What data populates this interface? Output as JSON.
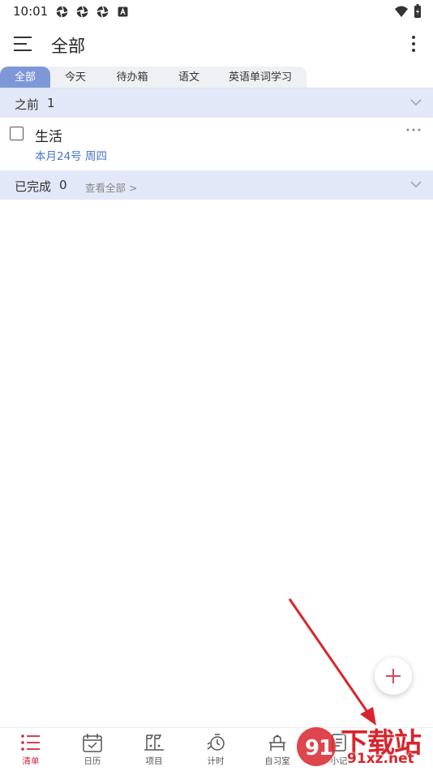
{
  "status_bar": {
    "time": "10:01",
    "left_icons": [
      "settings-icon",
      "settings-icon",
      "settings-icon",
      "keyboard-a-icon"
    ],
    "right_icons": [
      "wifi-icon",
      "battery-icon"
    ]
  },
  "header": {
    "title": "全部",
    "menu_icon": "menu-icon",
    "more_icon": "more-vertical-icon"
  },
  "tabs": [
    {
      "label": "全部",
      "active": true
    },
    {
      "label": "今天",
      "active": false
    },
    {
      "label": "待办箱",
      "active": false
    },
    {
      "label": "语文",
      "active": false
    },
    {
      "label": "英语单词学习",
      "active": false
    }
  ],
  "sections": {
    "before": {
      "label": "之前",
      "count": "1"
    },
    "done": {
      "label": "已完成",
      "count": "0",
      "link": "查看全部 >"
    }
  },
  "tasks": [
    {
      "name": "生活",
      "date": "本月24号 周四"
    }
  ],
  "fab": {
    "icon": "plus-icon"
  },
  "bottom_nav": [
    {
      "label": "清单",
      "icon": "list-icon",
      "active": true
    },
    {
      "label": "日历",
      "icon": "calendar-icon",
      "active": false
    },
    {
      "label": "项目",
      "icon": "project-icon",
      "active": false
    },
    {
      "label": "计时",
      "icon": "timer-icon",
      "active": false
    },
    {
      "label": "自习室",
      "icon": "study-room-icon",
      "active": false
    },
    {
      "label": "小记",
      "icon": "note-icon",
      "active": false
    }
  ],
  "watermark": {
    "line1": "下载站",
    "line2": "91xz.net"
  },
  "colors": {
    "accent": "#c9283c",
    "tab_active": "#7e97d9",
    "section_bg": "#e2e8f7",
    "date_blue": "#4a72c9",
    "arrow_red": "#d8252d"
  }
}
